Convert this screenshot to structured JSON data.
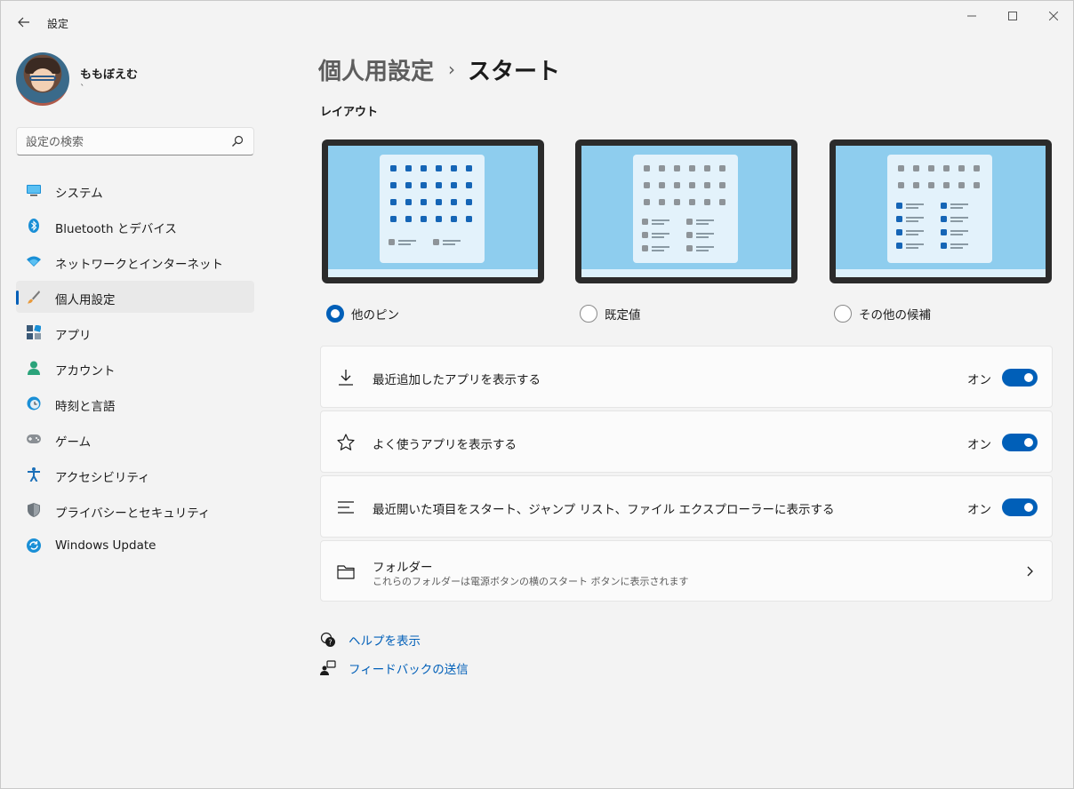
{
  "window": {
    "title": "設定"
  },
  "profile": {
    "name": "ももぼえむ",
    "sub": "`"
  },
  "search": {
    "placeholder": "設定の検索"
  },
  "sidebar": {
    "items": [
      {
        "label": "システム",
        "icon": "system-icon"
      },
      {
        "label": "Bluetooth とデバイス",
        "icon": "bluetooth-icon"
      },
      {
        "label": "ネットワークとインターネット",
        "icon": "network-icon"
      },
      {
        "label": "個人用設定",
        "icon": "personalization-icon",
        "selected": true
      },
      {
        "label": "アプリ",
        "icon": "apps-icon"
      },
      {
        "label": "アカウント",
        "icon": "account-icon"
      },
      {
        "label": "時刻と言語",
        "icon": "time-language-icon"
      },
      {
        "label": "ゲーム",
        "icon": "gaming-icon"
      },
      {
        "label": "アクセシビリティ",
        "icon": "accessibility-icon"
      },
      {
        "label": "プライバシーとセキュリティ",
        "icon": "privacy-icon"
      },
      {
        "label": "Windows Update",
        "icon": "windows-update-icon"
      }
    ]
  },
  "breadcrumb": {
    "parent": "個人用設定",
    "separator": "›",
    "current": "スタート"
  },
  "layout": {
    "title": "レイアウト",
    "options": [
      {
        "label": "他のピン",
        "checked": true
      },
      {
        "label": "既定値",
        "checked": false
      },
      {
        "label": "その他の候補",
        "checked": false
      }
    ]
  },
  "settings": {
    "recent_apps": {
      "label": "最近追加したアプリを表示する",
      "state": "オン",
      "on": true
    },
    "frequent_apps": {
      "label": "よく使うアプリを表示する",
      "state": "オン",
      "on": true
    },
    "recent_items": {
      "label": "最近開いた項目をスタート、ジャンプ リスト、ファイル エクスプローラーに表示する",
      "state": "オン",
      "on": true
    },
    "folders": {
      "label": "フォルダー",
      "sub": "これらのフォルダーは電源ボタンの横のスタート ボタンに表示されます"
    }
  },
  "links": {
    "help": "ヘルプを表示",
    "feedback": "フィードバックの送信"
  },
  "colors": {
    "accent": "#005fb8",
    "background": "#f3f3f3",
    "card": "#fbfbfb",
    "preview_bg": "#8ecdee"
  }
}
